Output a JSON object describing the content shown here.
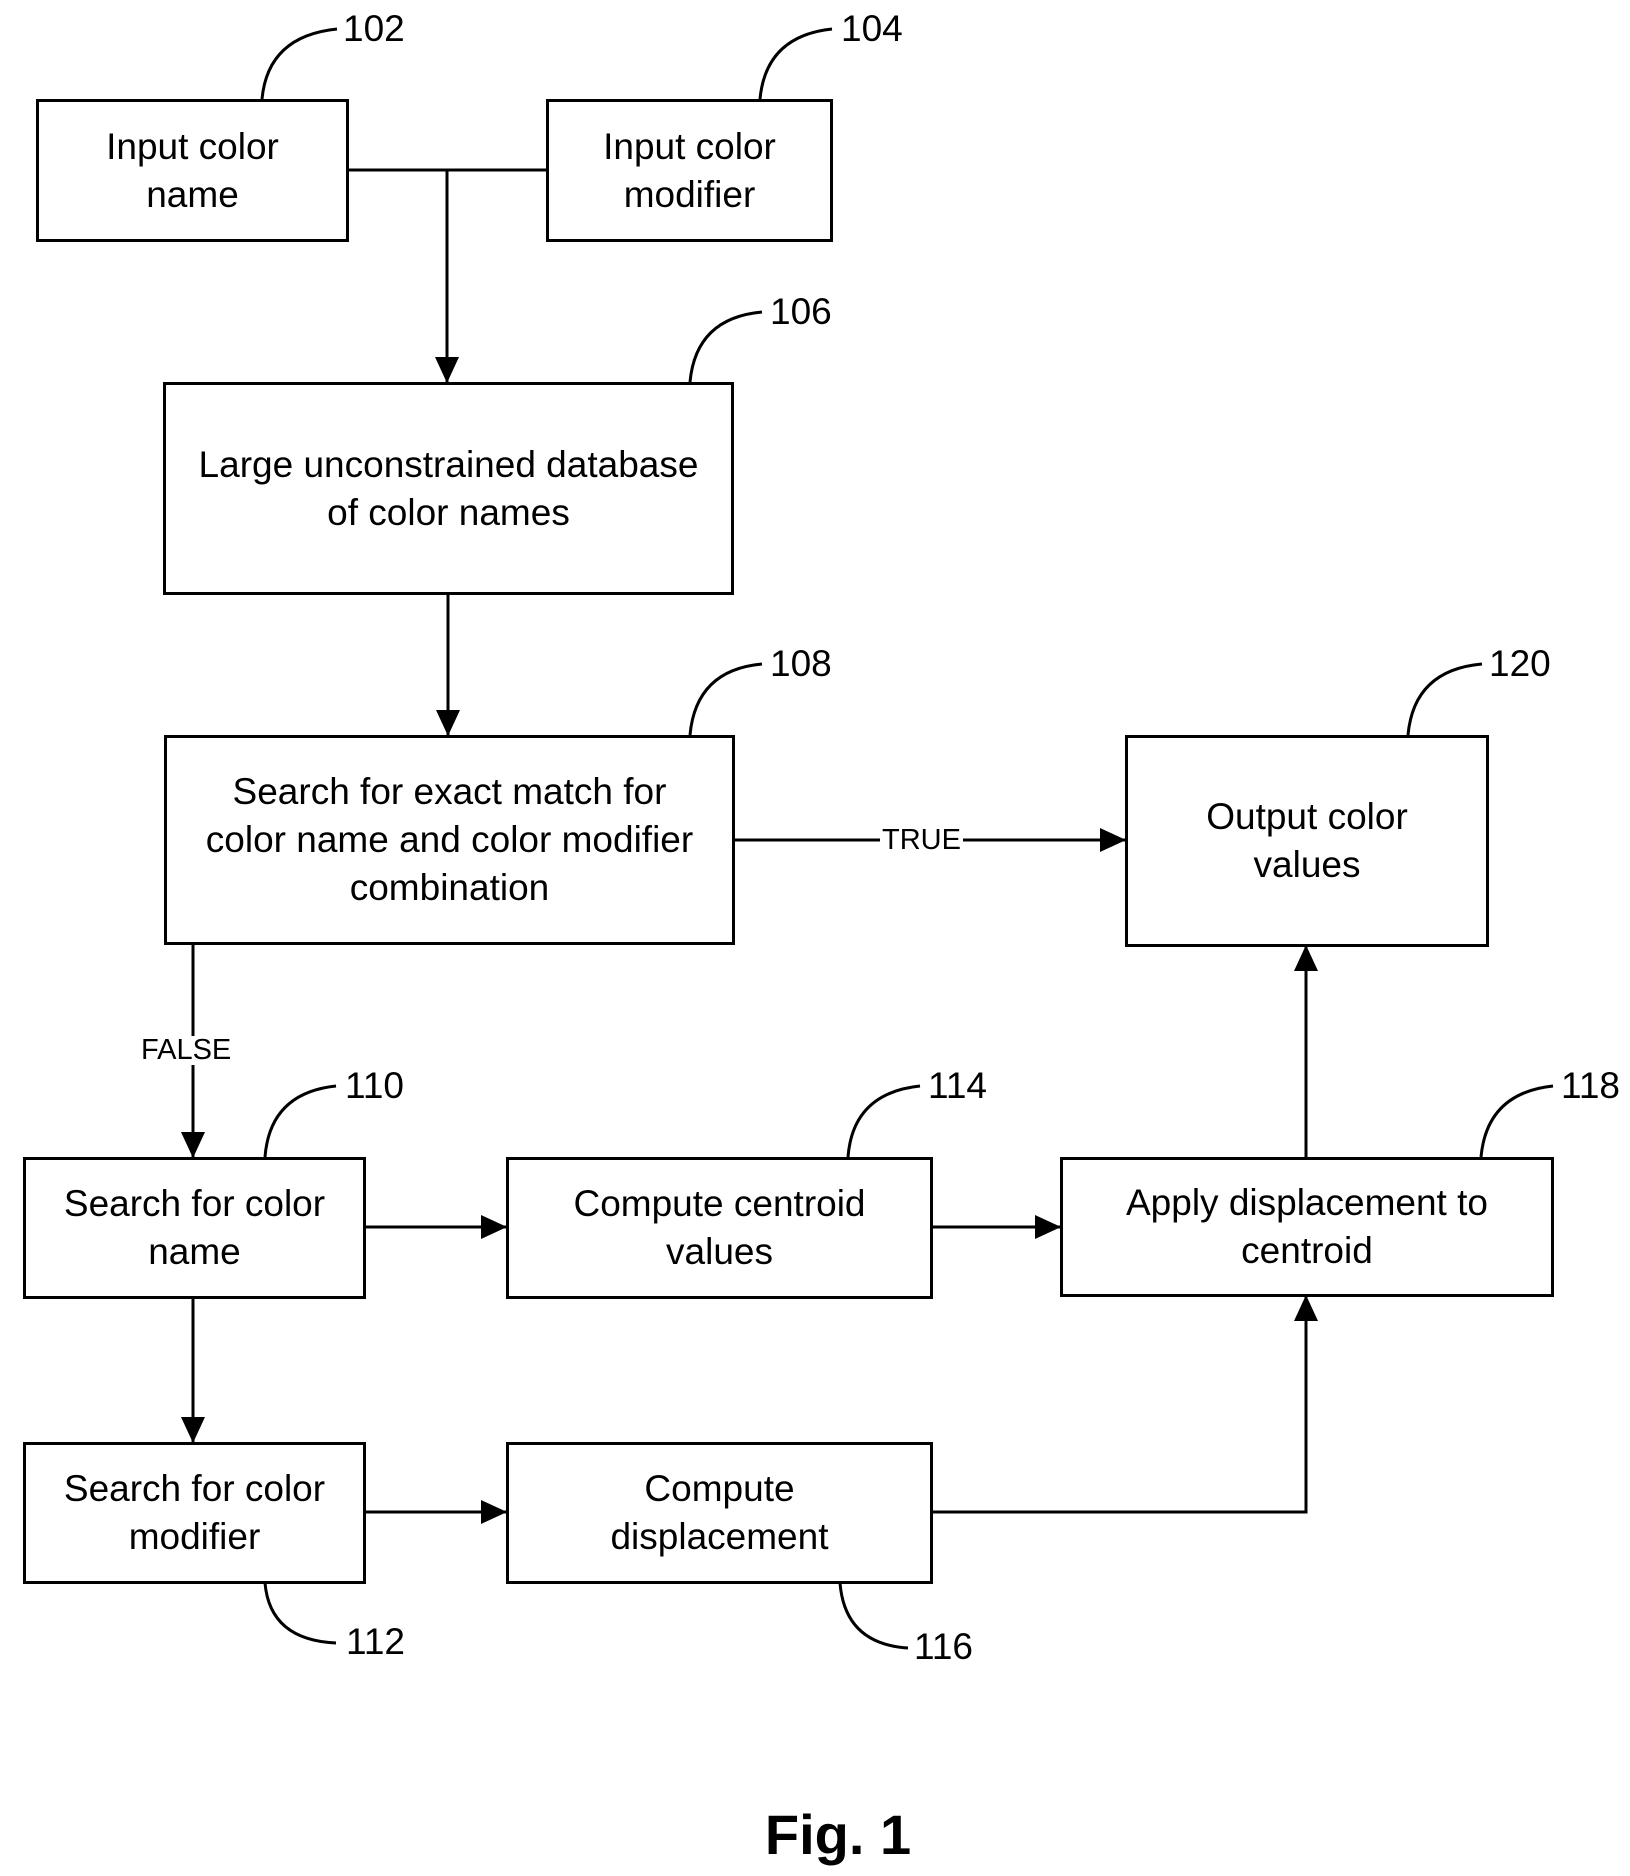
{
  "figure": {
    "caption": "Fig. 1",
    "nodes": [
      {
        "id": "102",
        "ref": "102",
        "lines": [
          "Input color",
          "name"
        ]
      },
      {
        "id": "104",
        "ref": "104",
        "lines": [
          "Input color",
          "modifier"
        ]
      },
      {
        "id": "106",
        "ref": "106",
        "lines": [
          "Large unconstrained database",
          "of color names"
        ]
      },
      {
        "id": "108",
        "ref": "108",
        "lines": [
          "Search for exact match for",
          "color name and color modifier",
          "combination"
        ]
      },
      {
        "id": "110",
        "ref": "110",
        "lines": [
          "Search for color",
          "name"
        ]
      },
      {
        "id": "112",
        "ref": "112",
        "lines": [
          "Search for color",
          "modifier"
        ]
      },
      {
        "id": "114",
        "ref": "114",
        "lines": [
          "Compute centroid",
          "values"
        ]
      },
      {
        "id": "116",
        "ref": "116",
        "lines": [
          "Compute",
          "displacement"
        ]
      },
      {
        "id": "118",
        "ref": "118",
        "lines": [
          "Apply displacement to",
          "centroid"
        ]
      },
      {
        "id": "120",
        "ref": "120",
        "lines": [
          "Output color",
          "values"
        ]
      }
    ],
    "edges": [
      {
        "from": "102",
        "to": "106",
        "label": ""
      },
      {
        "from": "104",
        "to": "106",
        "label": ""
      },
      {
        "from": "106",
        "to": "108",
        "label": ""
      },
      {
        "from": "108",
        "to": "120",
        "label": "TRUE"
      },
      {
        "from": "108",
        "to": "110",
        "label": "FALSE"
      },
      {
        "from": "110",
        "to": "114",
        "label": ""
      },
      {
        "from": "110",
        "to": "112",
        "label": ""
      },
      {
        "from": "112",
        "to": "116",
        "label": ""
      },
      {
        "from": "114",
        "to": "118",
        "label": ""
      },
      {
        "from": "116",
        "to": "118",
        "label": ""
      },
      {
        "from": "118",
        "to": "120",
        "label": ""
      }
    ]
  }
}
